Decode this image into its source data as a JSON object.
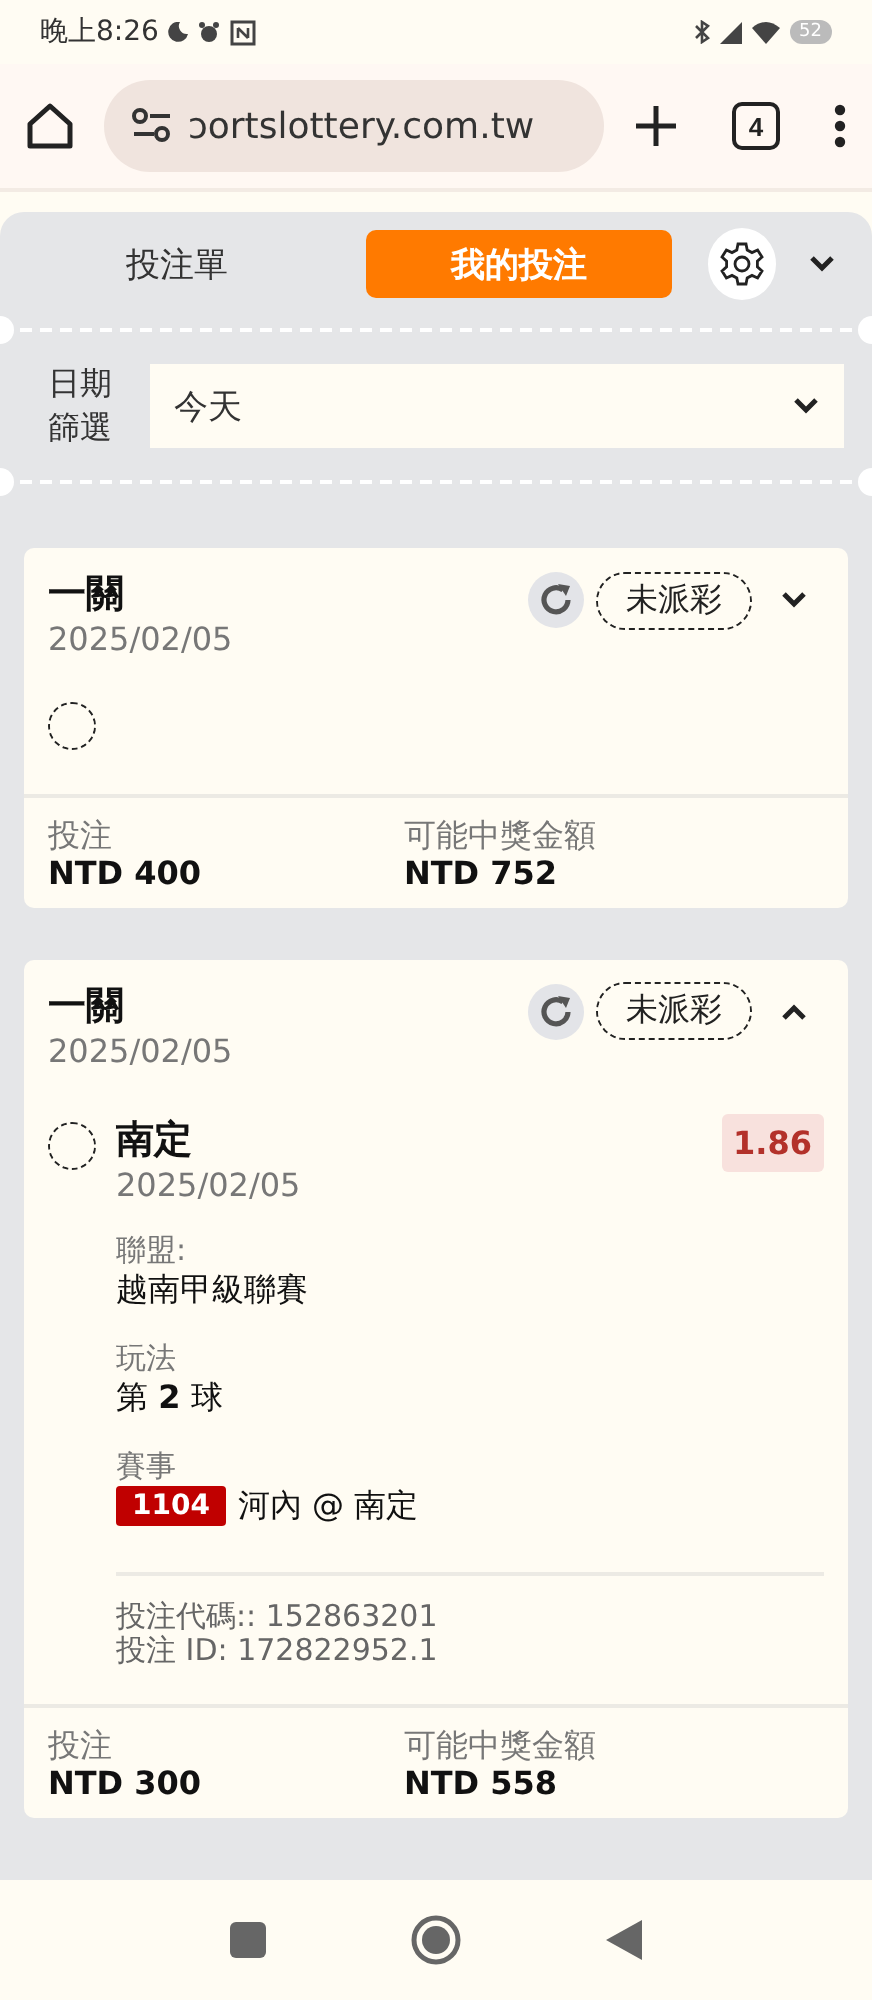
{
  "status_bar": {
    "time": "晚上8:26",
    "battery": "52"
  },
  "browser": {
    "url": "ɔortslottery.com.tw",
    "tab_count": "4"
  },
  "tabs": [
    {
      "label": "投注單",
      "selected": false
    },
    {
      "label": "我的投注",
      "selected": true
    }
  ],
  "filter": {
    "label": "日期篩選",
    "value": "今天"
  },
  "bets": [
    {
      "title": "一關",
      "date": "2025/02/05",
      "status": "未派彩",
      "expanded": false,
      "selections": [
        {
          "settled": false
        }
      ],
      "stake_label": "投注",
      "stake": "NTD 400",
      "payout_label": "可能中獎金額",
      "payout": "NTD 752"
    },
    {
      "title": "一關",
      "date": "2025/02/05",
      "status": "未派彩",
      "expanded": true,
      "selections": [
        {
          "settled": false,
          "name": "南定",
          "date": "2025/02/05",
          "odds": "1.86",
          "fields": [
            {
              "label": "聯盟:",
              "value": "越南甲級聯賽"
            },
            {
              "label": "玩法",
              "value": "第 **2** 球"
            }
          ],
          "event_label": "賽事",
          "event_code": "1104",
          "event": "河內 @ 南定",
          "codes": [
            "投注代碼:: 152863201",
            "投注 ID: 172822952.1"
          ]
        }
      ],
      "stake_label": "投注",
      "stake": "NTD 300",
      "payout_label": "可能中獎金額",
      "payout": "NTD 558"
    }
  ]
}
